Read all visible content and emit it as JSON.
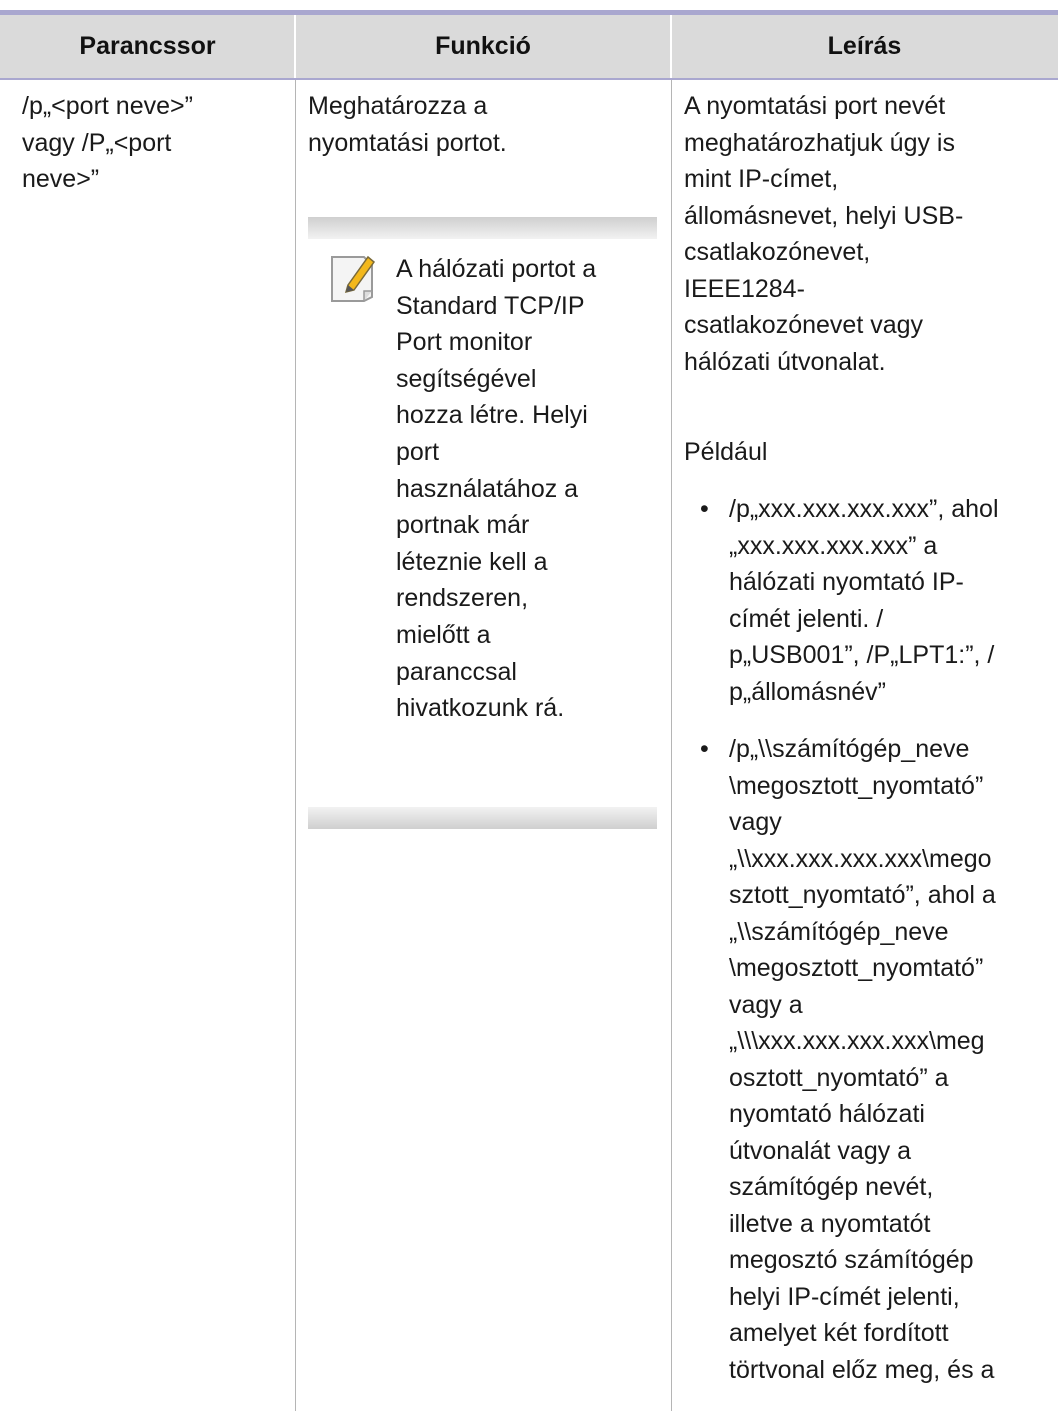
{
  "table": {
    "headers": [
      "Parancssor",
      "Funkció",
      "Leírás"
    ],
    "row": {
      "command_lines": [
        "/p„<port neve>”",
        "vagy /P„<port",
        "neve>”"
      ],
      "function_lines": [
        "Meghatározza a",
        "nyomtatási portot."
      ],
      "note": {
        "icon": "note-pencil-icon",
        "lines": [
          "A hálózati portot a",
          "Standard TCP/IP",
          "Port monitor",
          "segítségével",
          "hozza létre. Helyi",
          "port",
          "használatához a",
          "portnak már",
          "léteznie kell a",
          "rendszeren,",
          "mielőtt a",
          "paranccsal",
          "hivatkozunk rá."
        ]
      },
      "description_lines": [
        "A nyomtatási port nevét",
        "meghatározhatjuk úgy is",
        "mint IP-címet,",
        "állomásnevet, helyi USB-",
        "csatlakozónevet,",
        "IEEE1284-",
        "csatlakozónevet vagy",
        "hálózati útvonalat."
      ],
      "example_label": "Például",
      "bullets": [
        {
          "lines": [
            "/p„xxx.xxx.xxx.xxx”, ahol",
            "„xxx.xxx.xxx.xxx” a",
            "hálózati nyomtató IP-",
            "címét jelenti. /",
            "p„USB001”, /P„LPT1:”, /",
            "p„állomásnév”"
          ]
        },
        {
          "lines": [
            "/p„\\\\számítógép_neve",
            "\\megosztott_nyomtató”",
            "vagy",
            "„\\\\xxx.xxx.xxx.xxx\\mego",
            "sztott_nyomtató”, ahol a",
            "„\\\\számítógép_neve",
            "\\megosztott_nyomtató”",
            "vagy a",
            "„\\\\\\xxx.xxx.xxx.xxx\\meg",
            "osztott_nyomtató” a",
            "nyomtató hálózati",
            "útvonalát vagy a",
            "számítógép nevét,",
            "illetve a nyomtatót",
            "megosztó számítógép",
            "helyi IP-címét jelenti,",
            "amelyet két fordított",
            "törtvonal előz meg, és a"
          ]
        }
      ]
    }
  },
  "colors": {
    "header_bg": "#dadada",
    "accent_rule": "#a9a7cf",
    "grid_line": "#b5b5b5"
  }
}
